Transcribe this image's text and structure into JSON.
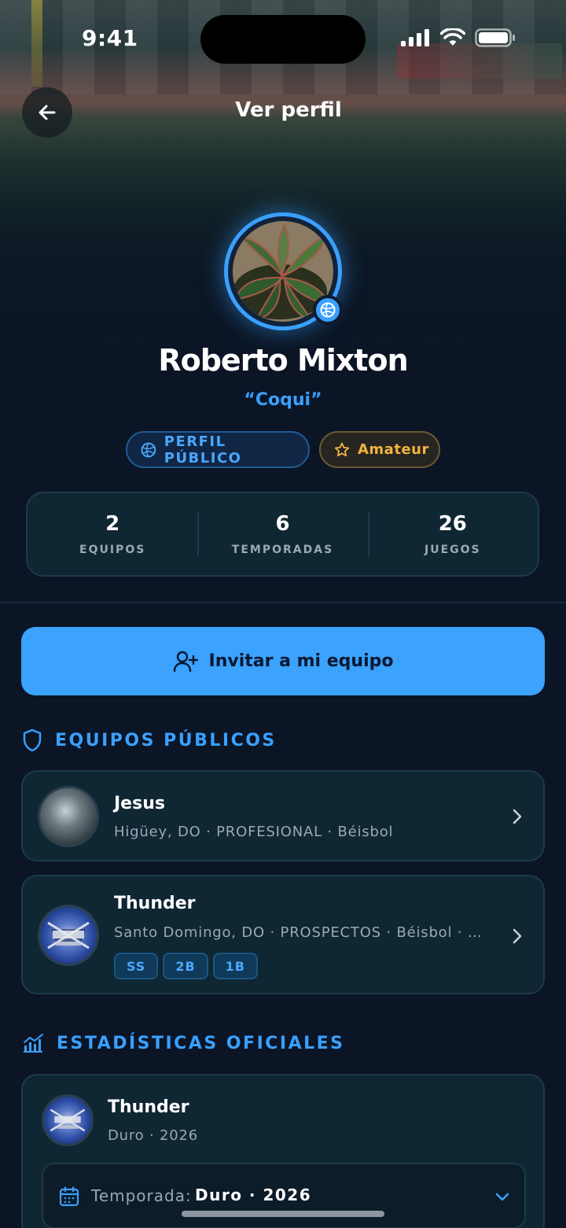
{
  "status_bar": {
    "time": "9:41"
  },
  "nav": {
    "title": "Ver perfil"
  },
  "profile": {
    "name": "Roberto Mixton",
    "nickname": "“Coqui”",
    "visibility_badge": "PERFIL PÚBLICO",
    "level_badge": "Amateur"
  },
  "stats": [
    {
      "value": "2",
      "label": "EQUIPOS"
    },
    {
      "value": "6",
      "label": "TEMPORADAS"
    },
    {
      "value": "26",
      "label": "JUEGOS"
    }
  ],
  "invite_button": {
    "label": "Invitar a mi equipo"
  },
  "public_teams": {
    "title": "EQUIPOS PÚBLICOS",
    "items": [
      {
        "name": "Jesus",
        "meta": "Higüey, DO · PROFESIONAL · Béisbol",
        "positions": []
      },
      {
        "name": "Thunder",
        "meta": "Santo Domingo, DO · PROSPECTOS · Béisbol · #…",
        "positions": [
          "SS",
          "2B",
          "1B"
        ]
      }
    ]
  },
  "official_stats": {
    "title": "ESTADÍSTICAS OFICIALES",
    "team_name": "Thunder",
    "team_meta": "Duro · 2026",
    "season_label": "Temporada:",
    "season_value": "Duro · 2026"
  },
  "colors": {
    "accent": "#3aa0ff",
    "button": "#3ba2fd",
    "level": "#f2b33d",
    "background": "#0b1526",
    "card": "#0f2633"
  },
  "icons": [
    "back-arrow-icon",
    "signal-icon",
    "wifi-icon",
    "battery-icon",
    "verified-icon",
    "globe-icon",
    "star-icon",
    "user-plus-icon",
    "shield-icon",
    "chart-icon",
    "chevron-right-icon",
    "calendar-icon",
    "chevron-down-icon"
  ]
}
